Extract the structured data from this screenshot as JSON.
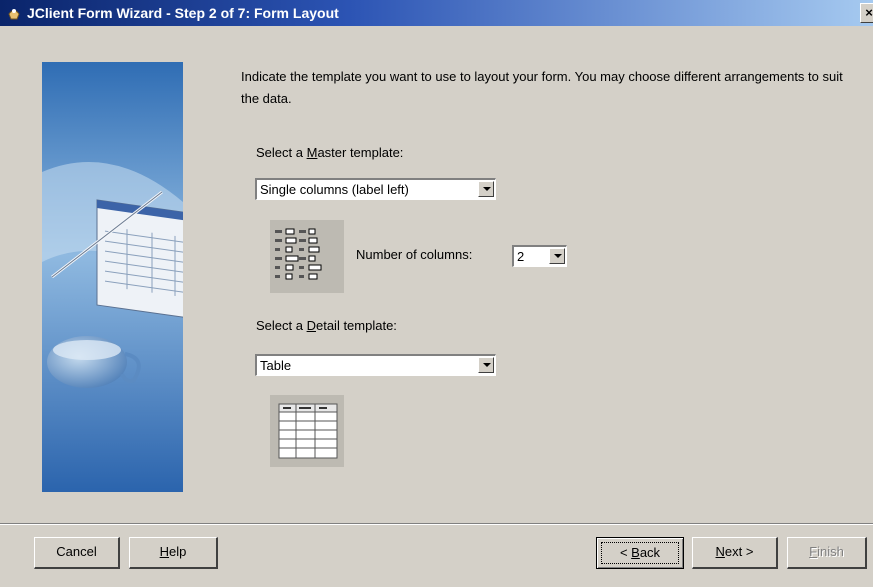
{
  "window": {
    "title": "JClient Form Wizard - Step 2 of 7: Form Layout",
    "close_label": "×"
  },
  "intro_text": "Indicate the template you want to use to layout your form. You may choose different arrangements to suit the data.",
  "master": {
    "label_pre": "Select a ",
    "label_mnemonic": "M",
    "label_post": "aster template:",
    "selected": "Single columns (label left)"
  },
  "columns": {
    "label": "Number of columns:",
    "selected": "2"
  },
  "detail": {
    "label_pre": "Select a ",
    "label_mnemonic": "D",
    "label_post": "etail template:",
    "selected": "Table"
  },
  "buttons": {
    "cancel": "Cancel",
    "help_mnemonic": "H",
    "help_rest": "elp",
    "back_prefix": "< ",
    "back_mnemonic": "B",
    "back_rest": "ack",
    "next_mnemonic": "N",
    "next_rest": "ext >",
    "finish_mnemonic": "F",
    "finish_rest": "inish"
  },
  "colors": {
    "title_start": "#0a246a",
    "title_end": "#a6caf0",
    "panel_blue": "#4f86c6",
    "dialog_bg": "#d4d0c8"
  }
}
